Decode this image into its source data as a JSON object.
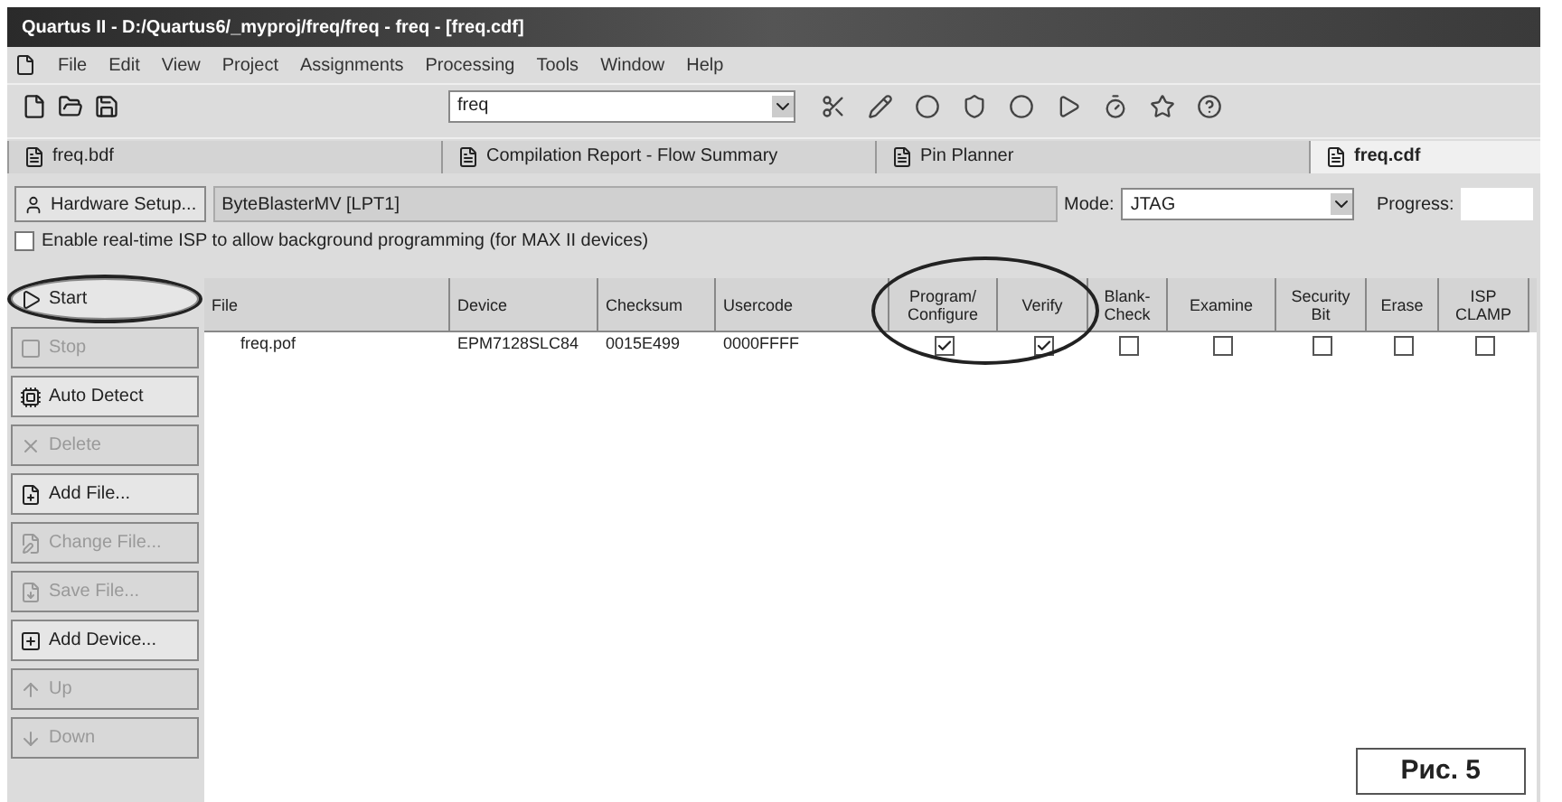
{
  "window": {
    "title": "Quartus II - D:/Quartus6/_myproj/freq/freq - freq - [freq.cdf]"
  },
  "menu": [
    "File",
    "Edit",
    "View",
    "Project",
    "Assignments",
    "Processing",
    "Tools",
    "Window",
    "Help"
  ],
  "toolbar": {
    "project_combo": "freq"
  },
  "tabs": [
    {
      "label": "freq.bdf",
      "selected": false
    },
    {
      "label": "Compilation Report - Flow Summary",
      "selected": false
    },
    {
      "label": "Pin Planner",
      "selected": false
    },
    {
      "label": "freq.cdf",
      "selected": true
    }
  ],
  "hardware": {
    "button": "Hardware Setup...",
    "device": "ByteBlasterMV [LPT1]",
    "mode_label": "Mode:",
    "mode": "JTAG",
    "progress_label": "Progress:"
  },
  "isp_option": {
    "label": "Enable real-time ISP to allow background programming (for MAX II devices)",
    "checked": false
  },
  "buttons": [
    {
      "label": "Start",
      "disabled": false,
      "highlighted": true
    },
    {
      "label": "Stop",
      "disabled": true,
      "highlighted": false
    },
    {
      "label": "Auto Detect",
      "disabled": false,
      "highlighted": false
    },
    {
      "label": "Delete",
      "disabled": true,
      "highlighted": false
    },
    {
      "label": "Add File...",
      "disabled": false,
      "highlighted": false
    },
    {
      "label": "Change File...",
      "disabled": true,
      "highlighted": false
    },
    {
      "label": "Save File...",
      "disabled": true,
      "highlighted": false
    },
    {
      "label": "Add Device...",
      "disabled": false,
      "highlighted": false
    },
    {
      "label": "Up",
      "disabled": true,
      "highlighted": false
    },
    {
      "label": "Down",
      "disabled": true,
      "highlighted": false
    }
  ],
  "table": {
    "columns": [
      {
        "label": "File",
        "kind": "text"
      },
      {
        "label": "Device",
        "kind": "text"
      },
      {
        "label": "Checksum",
        "kind": "text"
      },
      {
        "label": "Usercode",
        "kind": "text"
      },
      {
        "label": "Program/ Configure",
        "kind": "check",
        "highlighted": true
      },
      {
        "label": "Verify",
        "kind": "check",
        "highlighted": true
      },
      {
        "label": "Blank-Check",
        "kind": "check"
      },
      {
        "label": "Examine",
        "kind": "check"
      },
      {
        "label": "Security Bit",
        "kind": "check"
      },
      {
        "label": "Erase",
        "kind": "check"
      },
      {
        "label": "ISP CLAMP",
        "kind": "check"
      }
    ],
    "rows": [
      {
        "cells": [
          "freq.pof",
          "EPM7128SLC84",
          "0015E499",
          "0000FFFF"
        ],
        "checks": [
          true,
          true,
          false,
          false,
          false,
          false,
          false
        ]
      }
    ]
  },
  "caption": "Рис. 5"
}
